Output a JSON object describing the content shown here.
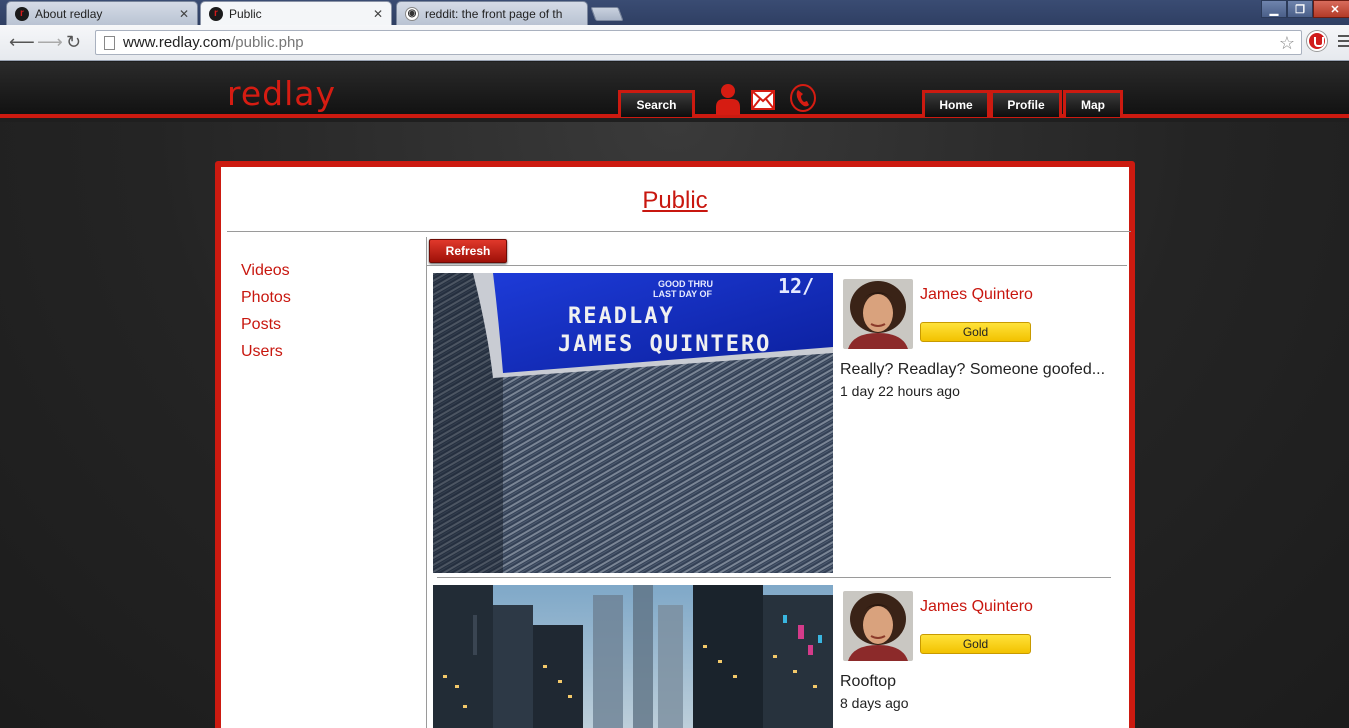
{
  "browser": {
    "tabs": [
      {
        "label": "About redlay",
        "favicon": "redlay-favicon-icon",
        "active": false
      },
      {
        "label": "Public",
        "favicon": "redlay-favicon-icon",
        "active": true
      },
      {
        "label": "reddit: the front page of th",
        "favicon": "reddit-favicon-icon",
        "active": false
      }
    ],
    "url": {
      "host": "www.redlay.com",
      "path": "/public.php"
    }
  },
  "site": {
    "logo": "redlay",
    "nav_left": {
      "search": "Search"
    },
    "icons": [
      "user-icon",
      "mail-icon",
      "phone-icon"
    ],
    "nav_right": {
      "home": "Home",
      "profile": "Profile",
      "map": "Map"
    },
    "accent_color": "#cc1a10"
  },
  "page": {
    "title": "Public",
    "sidebar": [
      "Videos",
      "Photos",
      "Posts",
      "Users"
    ],
    "refresh_label": "Refresh"
  },
  "posts": [
    {
      "author": "James Quintero",
      "badge": "Gold",
      "text": "Really? Readlay? Someone goofed...",
      "time": "1 day 22 hours ago",
      "image": {
        "card_line_1": "READLAY",
        "card_line_2": "JAMES QUINTERO",
        "card_small_1": "GOOD THRU",
        "card_small_2": "LAST DAY OF",
        "card_number": "12/"
      }
    },
    {
      "author": "James Quintero",
      "badge": "Gold",
      "text": "Rooftop",
      "time": "8 days ago"
    }
  ]
}
